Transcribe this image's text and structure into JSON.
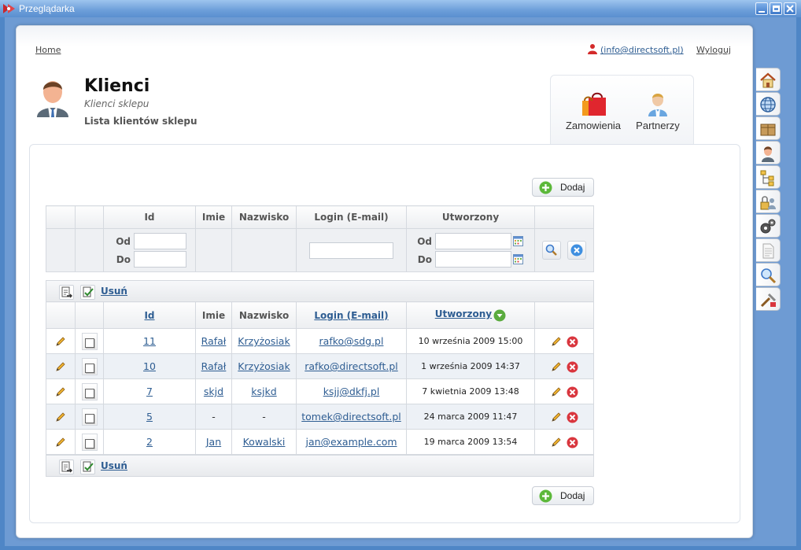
{
  "window": {
    "title": "Przeglądarka"
  },
  "nav": {
    "home": "Home",
    "user": "(info@directsoft.pl)",
    "logout": "Wyloguj"
  },
  "header": {
    "title": "Klienci",
    "subtitle": "Klienci sklepu",
    "description": "Lista klientów sklepu"
  },
  "shortcuts": {
    "orders": "Zamowienia",
    "partners": "Partnerzy"
  },
  "buttons": {
    "add": "Dodaj",
    "delete": "Usuń"
  },
  "filter": {
    "columns": [
      "Id",
      "Imie",
      "Nazwisko",
      "Login (E-mail)",
      "Utworzony"
    ],
    "from_label": "Od",
    "to_label": "Do"
  },
  "table": {
    "columns": {
      "id": "Id",
      "first_name": "Imie",
      "last_name": "Nazwisko",
      "login": "Login (E-mail)",
      "created": "Utworzony"
    },
    "rows": [
      {
        "id": "11",
        "first_name": "Rafał",
        "last_name": "Krzyżosiak",
        "login": "rafko@sdg.pl",
        "created": "10 września 2009 15:00"
      },
      {
        "id": "10",
        "first_name": "Rafał",
        "last_name": "Krzyżosiak",
        "login": "rafko@directsoft.pl",
        "created": "1 września 2009 14:37"
      },
      {
        "id": "7",
        "first_name": "skjd",
        "last_name": "ksjkd",
        "login": "ksjj@dkfj.pl",
        "created": "7 kwietnia 2009 13:48"
      },
      {
        "id": "5",
        "first_name": "-",
        "last_name": "-",
        "login": "tomek@directsoft.pl",
        "created": "24 marca 2009 11:47"
      },
      {
        "id": "2",
        "first_name": "Jan",
        "last_name": "Kowalski",
        "login": "jan@example.com",
        "created": "19 marca 2009 13:54"
      }
    ]
  },
  "icons": {
    "side_bar": [
      "home-icon",
      "globe-icon",
      "box-icon",
      "user-icon",
      "tree-icon",
      "lock-users-icon",
      "gears-icon",
      "document-icon",
      "search-tool-icon",
      "tools-icon"
    ],
    "row_edit": "pencil-icon",
    "row_delete": "delete-icon"
  },
  "colors": {
    "link": "#2e5d92",
    "delete": "#d9363e",
    "add": "#5cb83a",
    "titlebar": "#6c9ed9"
  }
}
